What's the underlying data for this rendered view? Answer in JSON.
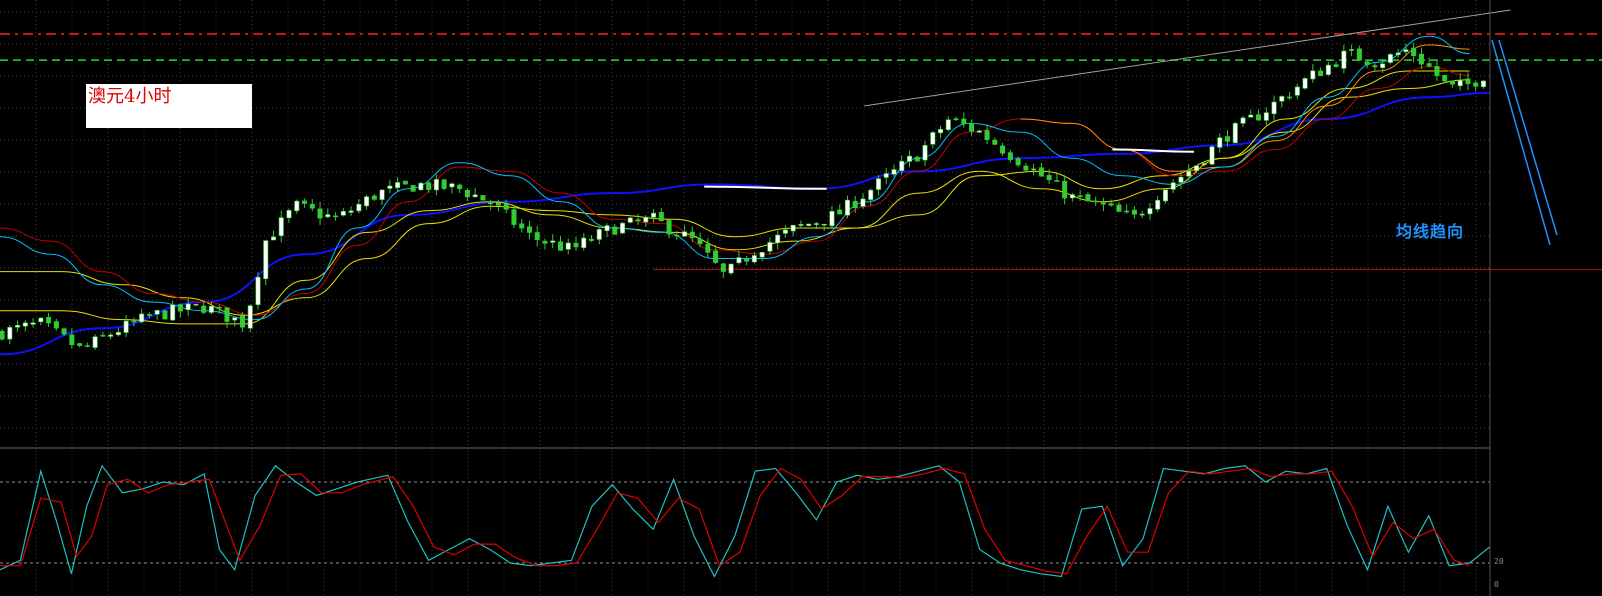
{
  "chart_title": "澳元4小时",
  "annotation": "均线趋向",
  "osc_labels": {
    "level_20": "20",
    "level_0": "0"
  },
  "colors": {
    "background": "#000000",
    "grid": "#3c3c3c",
    "bull_candle": "#ffffff",
    "bear_candle": "#32cd32",
    "resistance_line": "#ff2020",
    "support_line": "#22dd22",
    "support_low_line": "#b01010",
    "ma_blue": "#1010ff",
    "ma_yellow": "#e8e000",
    "ma_orange": "#ff8c00",
    "ma_red": "#c00000",
    "ma_cyan": "#00bfff",
    "osc_main": "#20c0c0",
    "osc_signal": "#e00000",
    "annotation": "#1e90ff"
  },
  "chart_data": [
    {
      "type": "candlestick",
      "title": "澳元4小时",
      "xlabel": "",
      "ylabel": "",
      "x_range": [
        0,
        1460
      ],
      "y_range": [
        0,
        100
      ],
      "grid": true,
      "horizontal_lines": [
        {
          "name": "",
          "value": 94.5,
          "style": "dash-dot",
          "color": "#ff2020"
        },
        {
          "name": "",
          "value": 88.5,
          "style": "dashed",
          "color": "#22dd22"
        },
        {
          "name": "",
          "value": 40.5,
          "style": "solid",
          "color": "#b01010",
          "x_start": 640
        }
      ],
      "trendlines": [
        {
          "x": [
            847,
            1480
          ],
          "y": [
            78,
            100
          ],
          "color": "#a0a0a0"
        }
      ],
      "price_anchor": {
        "x": [
          0,
          40,
          80,
          110,
          150,
          200,
          240,
          260,
          290,
          330,
          370,
          410,
          450,
          480,
          520,
          560,
          600,
          640,
          680,
          710,
          740,
          780,
          820,
          860,
          900,
          930,
          960,
          990,
          1020,
          1050,
          1080,
          1110,
          1140,
          1170,
          1200,
          1240,
          1280,
          1320,
          1350,
          1380,
          1400,
          1420,
          1440,
          1460
        ],
        "y": [
          26,
          28,
          22,
          26,
          30,
          32,
          28,
          47,
          55,
          52,
          58,
          60,
          59,
          56,
          48,
          45,
          50,
          52,
          47,
          39,
          45,
          50,
          53,
          60,
          67,
          75,
          72,
          67,
          62,
          57,
          55,
          52,
          59,
          64,
          71,
          77,
          84,
          90,
          88,
          91,
          87,
          82,
          83,
          86
        ]
      },
      "series": [
        {
          "name": "",
          "color": "#1010ff",
          "width": 2,
          "x": [
            0,
            100,
            200,
            300,
            400,
            500,
            600,
            700,
            800,
            900,
            1000,
            1100,
            1200,
            1300,
            1400,
            1460
          ],
          "y": [
            21,
            27,
            33,
            44,
            53,
            56,
            58,
            60,
            59,
            63,
            66,
            67,
            69,
            75,
            80,
            81
          ]
        },
        {
          "name": "",
          "color": "#e8e000",
          "width": 1,
          "x": [
            0,
            60,
            120,
            180,
            240,
            300,
            360,
            420,
            480,
            540,
            600,
            660,
            720,
            780,
            840,
            900,
            960,
            1020,
            1080,
            1140,
            1200,
            1260,
            1320,
            1380,
            1440
          ],
          "y": [
            40,
            40,
            37,
            34,
            30,
            34,
            43,
            51,
            55,
            54,
            53,
            52,
            48,
            50,
            50,
            53,
            62,
            63,
            59,
            62,
            66,
            72,
            80,
            82,
            84
          ]
        },
        {
          "name": "",
          "color": "#e8e000",
          "width": 1,
          "x": [
            0,
            60,
            120,
            180,
            240,
            300,
            360,
            420,
            480,
            540,
            600,
            660,
            720,
            780,
            840,
            900,
            960,
            1020,
            1080,
            1140,
            1200,
            1260,
            1320,
            1380,
            1440
          ],
          "y": [
            31,
            31,
            29,
            28,
            28,
            38,
            49,
            54,
            56,
            53,
            50,
            49,
            45,
            47,
            50,
            58,
            63,
            59,
            56,
            59,
            66,
            75,
            82,
            86,
            86
          ]
        },
        {
          "name": "",
          "color": "#c00000",
          "width": 1,
          "x": [
            0,
            50,
            100,
            150,
            200,
            250,
            300,
            350,
            400,
            450,
            500,
            550,
            600,
            650,
            700,
            750,
            800,
            850,
            900,
            950,
            1000,
            1050,
            1100,
            1150,
            1200,
            1250,
            1300,
            1350,
            1400,
            1440
          ],
          "y": [
            50,
            47,
            40,
            35,
            33,
            30,
            35,
            46,
            56,
            64,
            63,
            58,
            52,
            51,
            45,
            44,
            47,
            55,
            63,
            72,
            75,
            74,
            68,
            62,
            63,
            68,
            75,
            82,
            87,
            85
          ]
        },
        {
          "name": "",
          "color": "#ff8c00",
          "width": 1,
          "x": [
            1000,
            1050,
            1100,
            1150,
            1200,
            1250,
            1300,
            1350,
            1400,
            1440
          ],
          "y": [
            75,
            74,
            68,
            63,
            64,
            70,
            78,
            86,
            92,
            91
          ]
        },
        {
          "name": "",
          "color": "#00bfff",
          "width": 1,
          "x": [
            0,
            50,
            100,
            150,
            200,
            250,
            300,
            350,
            400,
            450,
            500,
            550,
            600,
            650,
            700,
            750,
            800,
            850,
            900,
            950,
            1000,
            1050,
            1100,
            1150,
            1200,
            1250,
            1300,
            1350,
            1400,
            1440
          ],
          "y": [
            48,
            44,
            37,
            33,
            31,
            29,
            36,
            50,
            59,
            65,
            62,
            56,
            50,
            49,
            43,
            43,
            48,
            56,
            66,
            74,
            72,
            66,
            62,
            60,
            64,
            71,
            80,
            88,
            94,
            90
          ]
        },
        {
          "name": "",
          "color": "#ffffff",
          "width": 2,
          "x": [
            690,
            810
          ],
          "y": [
            59.5,
            59
          ]
        },
        {
          "name": "",
          "color": "#ffffff",
          "width": 2,
          "x": [
            1090,
            1170
          ],
          "y": [
            68,
            67.5
          ]
        }
      ]
    },
    {
      "type": "line",
      "title": "",
      "xlabel": "",
      "ylabel": "",
      "x_range": [
        0,
        1460
      ],
      "y_range": [
        0,
        100
      ],
      "grid": true,
      "horizontal_lines": [
        {
          "name": "",
          "value": 80,
          "style": "dashed",
          "color": "#909090"
        },
        {
          "name": "",
          "value": 20,
          "style": "dashed",
          "color": "#909090"
        }
      ],
      "tick_labels": [
        "20",
        "0"
      ],
      "series": [
        {
          "name": "",
          "color": "#20c0c0",
          "x": [
            0,
            20,
            40,
            55,
            70,
            85,
            100,
            120,
            140,
            160,
            180,
            200,
            215,
            230,
            250,
            270,
            290,
            310,
            330,
            350,
            380,
            400,
            420,
            440,
            460,
            480,
            500,
            520,
            540,
            560,
            580,
            600,
            620,
            640,
            660,
            680,
            700,
            720,
            740,
            760,
            780,
            800,
            820,
            840,
            860,
            880,
            900,
            920,
            940,
            960,
            980,
            1000,
            1020,
            1040,
            1060,
            1080,
            1100,
            1120,
            1140,
            1160,
            1180,
            1200,
            1220,
            1240,
            1260,
            1280,
            1300,
            1320,
            1340,
            1360,
            1380,
            1400,
            1420,
            1440,
            1460
          ],
          "y": [
            15,
            22,
            88,
            52,
            12,
            62,
            92,
            72,
            75,
            80,
            78,
            86,
            30,
            15,
            70,
            92,
            80,
            70,
            75,
            80,
            85,
            50,
            22,
            30,
            38,
            30,
            20,
            18,
            20,
            22,
            62,
            78,
            60,
            45,
            82,
            40,
            10,
            40,
            88,
            90,
            72,
            52,
            80,
            85,
            82,
            84,
            88,
            92,
            80,
            30,
            20,
            15,
            12,
            10,
            60,
            62,
            18,
            38,
            90,
            88,
            86,
            90,
            92,
            80,
            88,
            86,
            90,
            48,
            15,
            62,
            28,
            55,
            18,
            20,
            32
          ]
        },
        {
          "name": "",
          "color": "#e00000",
          "x": [
            0,
            20,
            40,
            60,
            75,
            90,
            105,
            125,
            145,
            165,
            185,
            205,
            220,
            235,
            255,
            275,
            295,
            315,
            335,
            355,
            385,
            405,
            425,
            445,
            465,
            485,
            505,
            525,
            545,
            565,
            585,
            605,
            625,
            645,
            665,
            685,
            705,
            725,
            745,
            765,
            785,
            805,
            825,
            845,
            865,
            885,
            905,
            925,
            945,
            965,
            985,
            1005,
            1025,
            1045,
            1065,
            1085,
            1105,
            1125,
            1145,
            1165,
            1185,
            1205,
            1225,
            1245,
            1265,
            1285,
            1305,
            1325,
            1345,
            1365,
            1385,
            1405,
            1425,
            1440
          ],
          "y": [
            18,
            18,
            68,
            65,
            25,
            40,
            78,
            82,
            72,
            78,
            80,
            82,
            52,
            22,
            48,
            85,
            86,
            72,
            72,
            78,
            84,
            62,
            32,
            26,
            34,
            34,
            24,
            18,
            18,
            20,
            45,
            72,
            68,
            50,
            68,
            60,
            18,
            28,
            70,
            90,
            82,
            60,
            70,
            84,
            84,
            83,
            86,
            90,
            86,
            45,
            22,
            18,
            14,
            12,
            40,
            62,
            28,
            28,
            72,
            88,
            86,
            88,
            90,
            84,
            86,
            86,
            88,
            62,
            25,
            50,
            38,
            45,
            22,
            18
          ]
        }
      ]
    }
  ]
}
